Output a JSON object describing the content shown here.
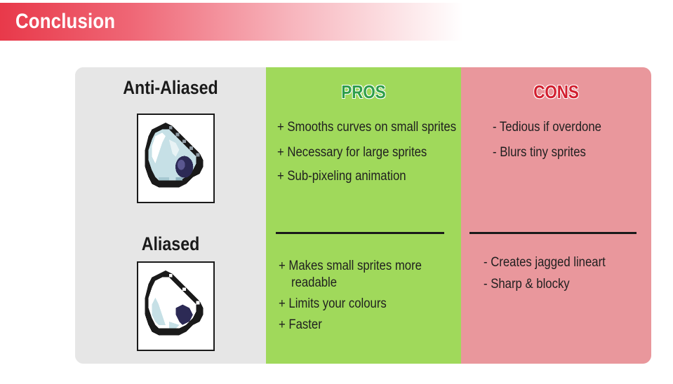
{
  "header": {
    "title": "Conclusion"
  },
  "left": {
    "anti_aliased_label": "Anti-Aliased",
    "aliased_label": "Aliased"
  },
  "pros": {
    "heading": "PROS",
    "anti_aliased": [
      "+ Smooths curves on small sprites",
      "+ Necessary for large sprites",
      "+ Sub-pixeling animation"
    ],
    "aliased": [
      "+ Makes small sprites more",
      "readable",
      "+ Limits your colours",
      "+ Faster"
    ]
  },
  "cons": {
    "heading": "CONS",
    "anti_aliased": [
      "- Tedious if overdone",
      "- Blurs tiny sprites"
    ],
    "aliased": [
      "- Creates jagged lineart",
      "- Sharp & blocky"
    ]
  },
  "colors": {
    "banner_red": "#e8394a",
    "pros_bg": "#a0d95b",
    "cons_bg": "#e9979c",
    "left_bg": "#e6e6e6",
    "pros_heading": "#2e9e4a",
    "cons_heading": "#d21f2f"
  }
}
